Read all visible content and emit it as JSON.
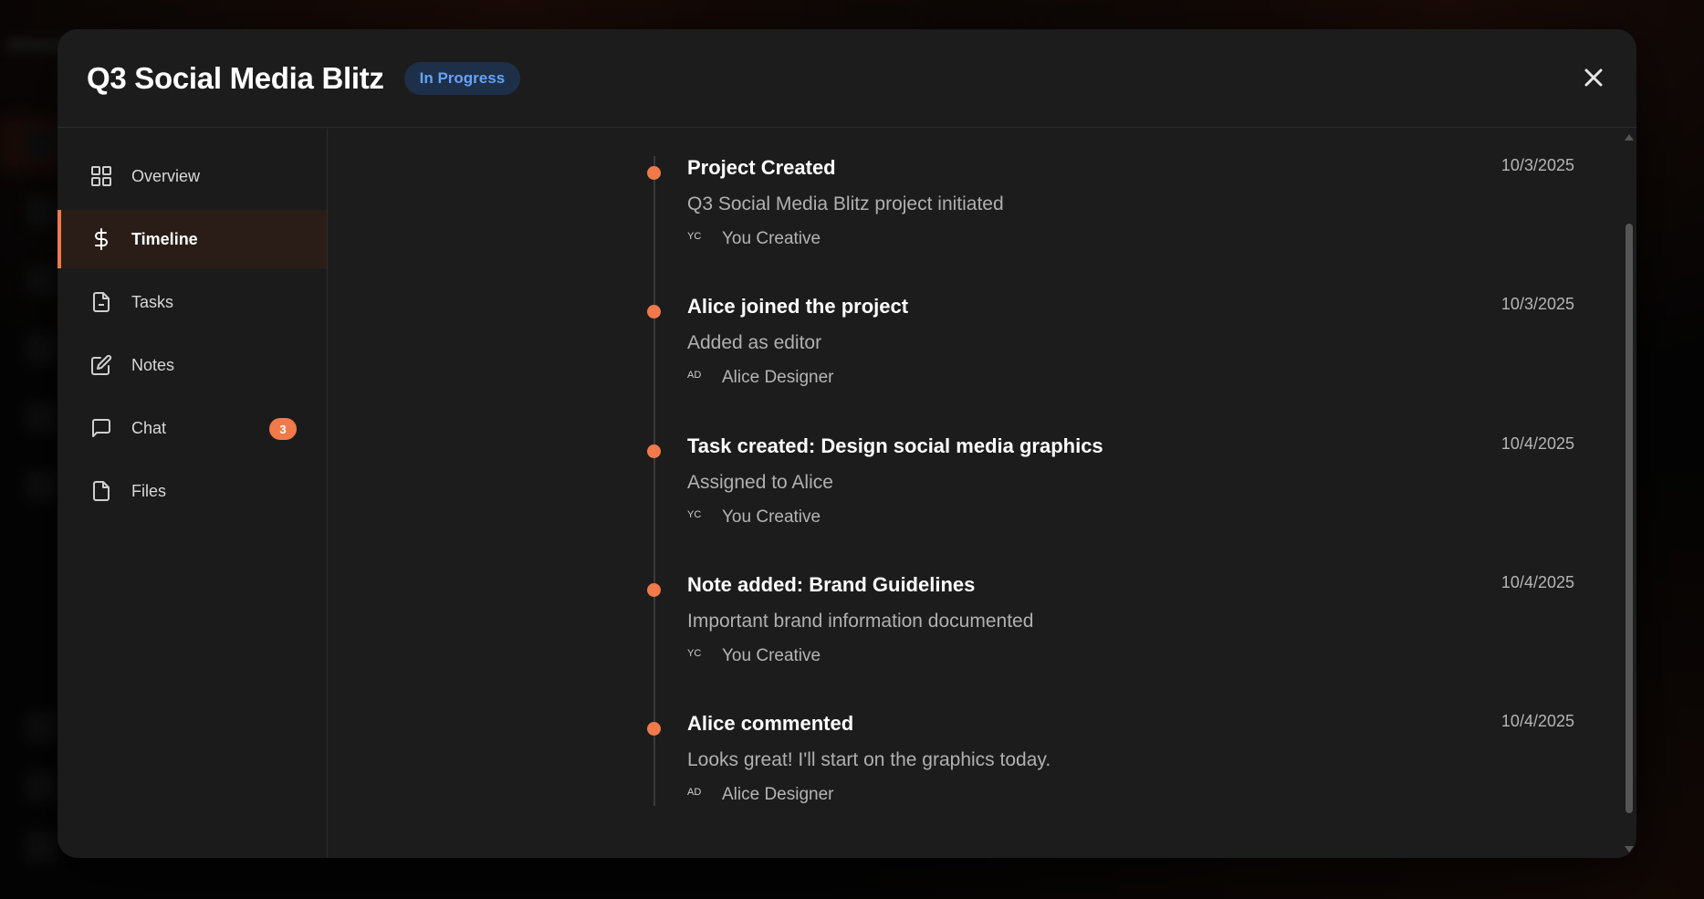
{
  "modal": {
    "title": "Q3 Social Media Blitz",
    "status": "In Progress",
    "close_icon": "close-icon"
  },
  "colors": {
    "accent": "#f07a4a",
    "badge_bg": "#1e2f4a",
    "badge_text": "#64a3f5",
    "modal_bg": "#1c1c1c"
  },
  "sidebar": {
    "items": [
      {
        "label": "Overview",
        "icon": "grid-icon",
        "active": false
      },
      {
        "label": "Timeline",
        "icon": "dollar-icon",
        "active": true
      },
      {
        "label": "Tasks",
        "icon": "file-text-icon",
        "active": false
      },
      {
        "label": "Notes",
        "icon": "edit-icon",
        "active": false
      },
      {
        "label": "Chat",
        "icon": "message-icon",
        "active": false,
        "badge": "3"
      },
      {
        "label": "Files",
        "icon": "file-icon",
        "active": false
      }
    ]
  },
  "timeline": {
    "events": [
      {
        "title": "Project Created",
        "date": "10/3/2025",
        "description": "Q3 Social Media Blitz project initiated",
        "avatar": "YC",
        "author": "You Creative"
      },
      {
        "title": "Alice joined the project",
        "date": "10/3/2025",
        "description": "Added as editor",
        "avatar": "AD",
        "author": "Alice Designer"
      },
      {
        "title": "Task created: Design social media graphics",
        "date": "10/4/2025",
        "description": "Assigned to Alice",
        "avatar": "YC",
        "author": "You Creative"
      },
      {
        "title": "Note added: Brand Guidelines",
        "date": "10/4/2025",
        "description": "Important brand information documented",
        "avatar": "YC",
        "author": "You Creative"
      },
      {
        "title": "Alice commented",
        "date": "10/4/2025",
        "description": "Looks great! I'll start on the graphics today.",
        "avatar": "AD",
        "author": "Alice Designer"
      }
    ]
  }
}
